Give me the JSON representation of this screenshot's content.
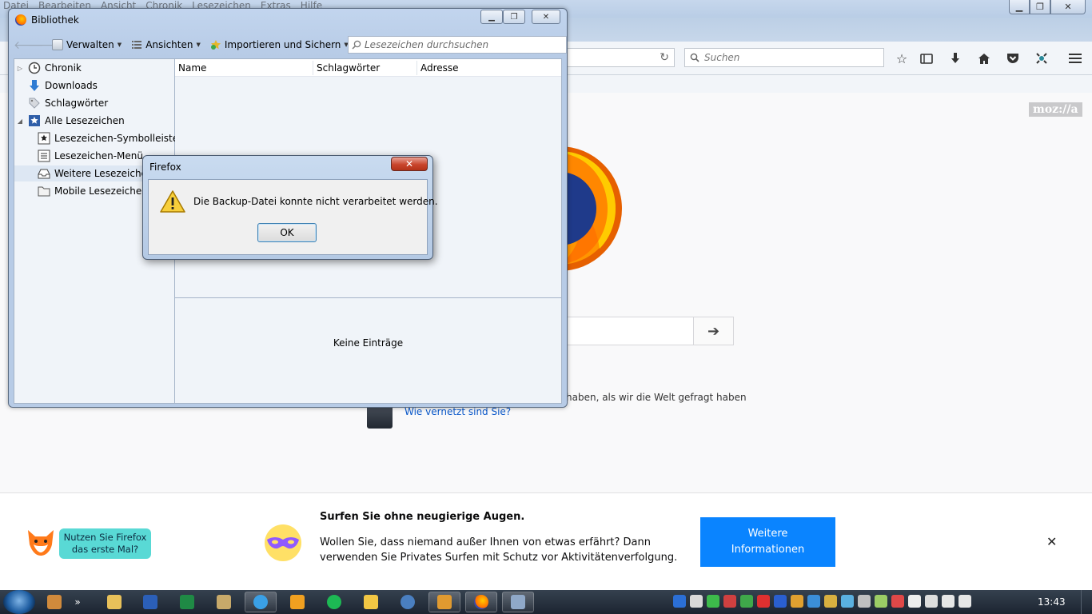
{
  "firefox": {
    "menubar": [
      "Datei",
      "Bearbeiten",
      "Ansicht",
      "Chronik",
      "Lesezeichen",
      "Extras",
      "Hilfe"
    ],
    "search_placeholder": "Suchen",
    "mozilla_logo": "moz://a",
    "snippet_text": "haben, als wir die Welt gefragt haben",
    "snippet_link": "Wie vernetzt sind Sie?",
    "icons": [
      "reload-icon",
      "search-icon",
      "star-icon",
      "library-icon",
      "download-icon",
      "home-icon",
      "pocket-icon",
      "customize-icon",
      "hamburger-menu-icon",
      "arrow-right-icon"
    ]
  },
  "onboarding": {
    "bubble": "Nutzen Sie Firefox das erste Mal?",
    "title": "Surfen Sie ohne neugierige Augen.",
    "text": "Wollen Sie, dass niemand außer Ihnen von etwas erfährt? Dann verwenden Sie Privates Surfen mit Schutz vor Aktivitätenverfolgung.",
    "cta": "Weitere Informationen",
    "close": "✕"
  },
  "library": {
    "title": "Bibliothek",
    "toolbar": {
      "organize": "Verwalten",
      "views": "Ansichten",
      "import_backup": "Importieren und Sichern",
      "search_placeholder": "Lesezeichen durchsuchen"
    },
    "tree": [
      {
        "label": "Chronik",
        "icon": "clock-icon"
      },
      {
        "label": "Downloads",
        "icon": "download-icon"
      },
      {
        "label": "Schlagwörter",
        "icon": "tag-icon"
      },
      {
        "label": "Alle Lesezeichen",
        "icon": "bookmarks-star-icon"
      },
      {
        "label": "Lesezeichen-Symbolleiste",
        "icon": "toolbar-icon"
      },
      {
        "label": "Lesezeichen-Menü",
        "icon": "menu-list-icon"
      },
      {
        "label": "Weitere Lesezeichen",
        "icon": "tray-icon"
      },
      {
        "label": "Mobile Lesezeichen",
        "icon": "folder-icon"
      }
    ],
    "columns": [
      "Name",
      "Schlagwörter",
      "Adresse"
    ],
    "empty_text": "Keine Einträge"
  },
  "alert": {
    "title": "Firefox",
    "message": "Die Backup-Datei konnte nicht verarbeitet werden.",
    "ok": "OK",
    "close": "✕"
  },
  "taskbar": {
    "clock": "13:43",
    "colors": {
      "start": "#1e5da1",
      "accent": "#0a84ff"
    }
  }
}
